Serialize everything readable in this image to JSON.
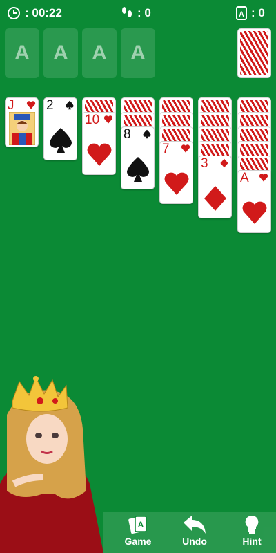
{
  "status": {
    "time": "00:22",
    "moves": "0",
    "score": "0"
  },
  "foundations": [
    "A",
    "A",
    "A",
    "A"
  ],
  "tableau": [
    {
      "rank": "J",
      "suit": "hearts"
    },
    {
      "rank": "2",
      "suit": "spades"
    },
    {
      "rank": "10",
      "suit": "hearts"
    },
    {
      "rank": "8",
      "suit": "spades"
    },
    {
      "rank": "7",
      "suit": "hearts"
    },
    {
      "rank": "3",
      "suit": "diamonds"
    },
    {
      "rank": "A",
      "suit": "hearts"
    }
  ],
  "toolbar": {
    "game_label": "Game",
    "undo_label": "Undo",
    "hint_label": "Hint"
  },
  "colors": {
    "felt": "#0b8a35",
    "card_red": "#d11a1a"
  }
}
